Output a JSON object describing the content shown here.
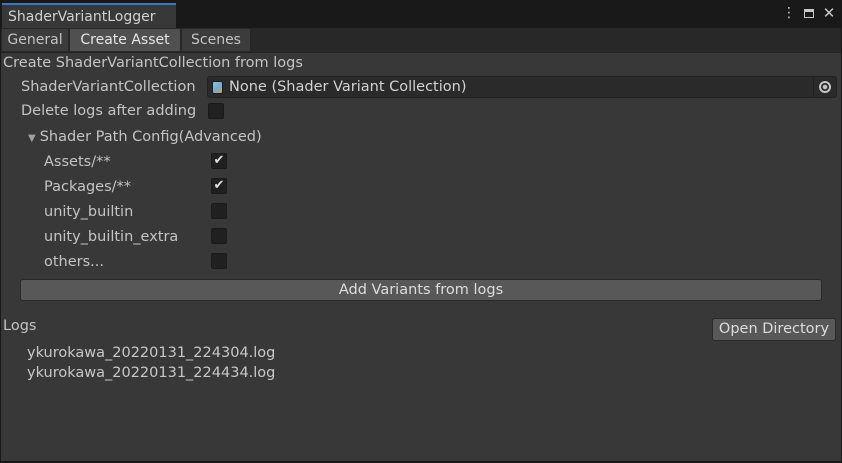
{
  "window": {
    "title": "ShaderVariantLogger",
    "icons": {
      "menu": "kebab-menu-icon",
      "maximize": "maximize-icon",
      "close": "close-icon"
    }
  },
  "tabs": [
    {
      "label": "General",
      "active": false
    },
    {
      "label": "Create Asset",
      "active": true
    },
    {
      "label": "Scenes",
      "active": false
    }
  ],
  "main": {
    "heading": "Create ShaderVariantCollection from logs",
    "collection_field": {
      "label": "ShaderVariantCollection",
      "value": "None (Shader Variant Collection)",
      "icon": "shader-variant-collection-icon",
      "picker_icon": "object-picker-icon"
    },
    "delete_logs": {
      "label": "Delete logs after adding",
      "checked": false
    },
    "foldout": {
      "label": "Shader Path Config(Advanced)",
      "expanded": true,
      "items": [
        {
          "label": "Assets/**",
          "checked": true
        },
        {
          "label": "Packages/**",
          "checked": true
        },
        {
          "label": "unity_builtin",
          "checked": false
        },
        {
          "label": "unity_builtin_extra",
          "checked": false
        },
        {
          "label": "others...",
          "checked": false
        }
      ]
    },
    "add_button": "Add Variants from logs",
    "logs_label": "Logs",
    "open_directory_button": "Open Directory",
    "logs": [
      "ykurokawa_20220131_224304.log",
      "ykurokawa_20220131_224434.log"
    ]
  },
  "colors": {
    "background": "#383838",
    "titlebar": "#191919",
    "accent": "#3a79bb",
    "button": "#585858",
    "field": "#2a2a2a"
  }
}
